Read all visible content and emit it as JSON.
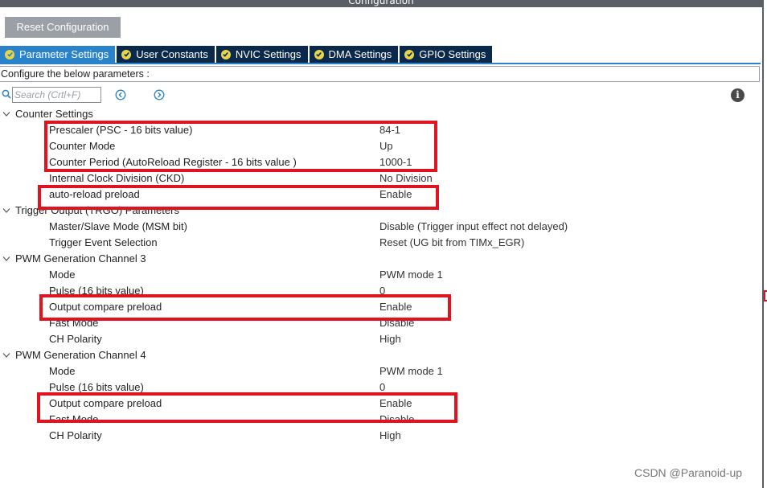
{
  "window": {
    "title": "Configuration"
  },
  "toolbar": {
    "reset_label": "Reset Configuration"
  },
  "tabs": [
    {
      "label": "Parameter Settings",
      "active": true
    },
    {
      "label": "User Constants",
      "active": false
    },
    {
      "label": "NVIC Settings",
      "active": false
    },
    {
      "label": "DMA Settings",
      "active": false
    },
    {
      "label": "GPIO Settings",
      "active": false
    }
  ],
  "description": "Configure the below parameters :",
  "search": {
    "placeholder": "Search (Crtl+F)"
  },
  "groups": {
    "counter": {
      "title": "Counter Settings",
      "params": [
        {
          "name": "Prescaler (PSC - 16 bits value)",
          "value": "84-1"
        },
        {
          "name": "Counter Mode",
          "value": "Up"
        },
        {
          "name": "Counter Period (AutoReload Register - 16 bits value )",
          "value": "1000-1"
        },
        {
          "name": "Internal Clock Division (CKD)",
          "value": "No Division"
        },
        {
          "name": "auto-reload preload",
          "value": "Enable"
        }
      ]
    },
    "trigger": {
      "title": "Trigger Output (TRGO) Parameters",
      "params": [
        {
          "name": "Master/Slave Mode (MSM bit)",
          "value": "Disable (Trigger input effect not delayed)"
        },
        {
          "name": "Trigger Event Selection",
          "value": "Reset (UG bit from TIMx_EGR)"
        }
      ]
    },
    "pwm3": {
      "title": "PWM Generation Channel 3",
      "params": [
        {
          "name": "Mode",
          "value": "PWM mode 1"
        },
        {
          "name": "Pulse (16 bits value)",
          "value": "0"
        },
        {
          "name": "Output compare preload",
          "value": "Enable"
        },
        {
          "name": "Fast Mode",
          "value": "Disable"
        },
        {
          "name": "CH Polarity",
          "value": "High"
        }
      ]
    },
    "pwm4": {
      "title": "PWM Generation Channel 4",
      "params": [
        {
          "name": "Mode",
          "value": "PWM mode 1"
        },
        {
          "name": "Pulse (16 bits value)",
          "value": "0"
        },
        {
          "name": "Output compare preload",
          "value": "Enable"
        },
        {
          "name": "Fast Mode",
          "value": "Disable"
        },
        {
          "name": "CH Polarity",
          "value": "High"
        }
      ]
    }
  },
  "watermark": "CSDN @Paranoid-up",
  "colors": {
    "tab_active": "#2a82c9",
    "tab_inactive": "#0b2a4b",
    "check_badge": "#e7d44a",
    "highlight_box": "#e0131f",
    "button_gray": "#9aa0a6"
  }
}
